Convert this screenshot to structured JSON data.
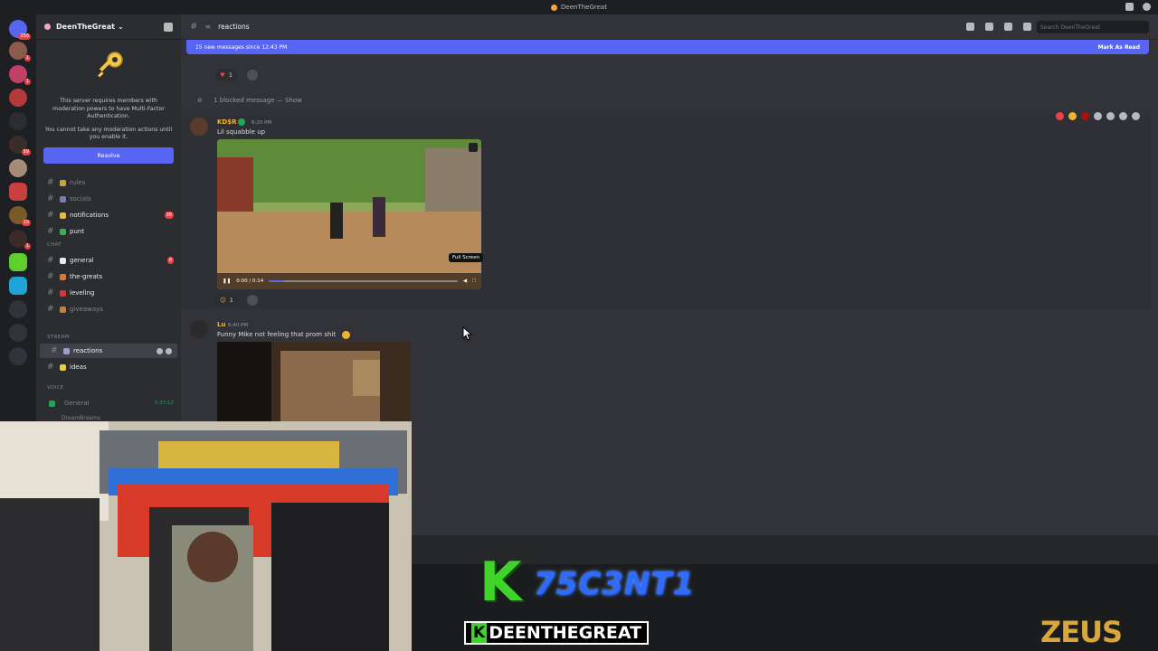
{
  "window": {
    "title": "DeenTheGreat"
  },
  "server": {
    "name": "DeenTheGreat",
    "server_badges": [
      "256",
      "1",
      "1",
      "59",
      "10",
      "1"
    ]
  },
  "mfa": {
    "line1": "This server requires members with moderation powers to have Multi-Factor Authentication.",
    "line2": "You cannot take any moderation actions until you enable it.",
    "button": "Resolve"
  },
  "channels": [
    {
      "name": "rules",
      "style": "muted"
    },
    {
      "name": "socials",
      "style": "muted"
    },
    {
      "name": "notifications",
      "style": "bright",
      "count": "38"
    },
    {
      "name": "punt",
      "style": "bright"
    },
    {
      "name": "general",
      "style": "bright",
      "count": "8"
    },
    {
      "name": "the-greats",
      "style": "bright"
    },
    {
      "name": "leveling",
      "style": "bright"
    },
    {
      "name": "giveaways",
      "style": "muted"
    },
    {
      "name": "reactions",
      "style": "active"
    },
    {
      "name": "ideas",
      "style": "bright"
    }
  ],
  "categories": {
    "chat": "CHAT",
    "stream": "STREAM",
    "voice": "VOICE"
  },
  "voice": {
    "name": "General",
    "time": "5:37:12",
    "user": "DreamBreams"
  },
  "topbar": {
    "channel": "reactions",
    "search_placeholder": "Search DeenTheGreat"
  },
  "new_messages": {
    "text": "15 new messages since 12:43 PM",
    "action": "Mark As Read"
  },
  "reactions_top": {
    "count": "1"
  },
  "blocked": {
    "text": "1 blocked message —",
    "link": "Show"
  },
  "message1": {
    "author": "KD$R",
    "time": "6:20 PM",
    "text": "Lil squabble up",
    "video_time": "0:00 / 0:14",
    "tooltip": "Full Screen",
    "reaction_count": "1"
  },
  "message2": {
    "author": "Lu",
    "time": "6:40 PM",
    "text": "Funny Mike not feeling that prom shit"
  },
  "overlay": {
    "k_text": "75C3NT1",
    "handle": "DEENTHEGREAT",
    "handle_prefix": "K",
    "sponsor": "ZEUS"
  },
  "colors": {
    "blurple": "#5865f2",
    "bg": "#313338",
    "sidebar": "#2b2d31",
    "green": "#3fd32c"
  }
}
